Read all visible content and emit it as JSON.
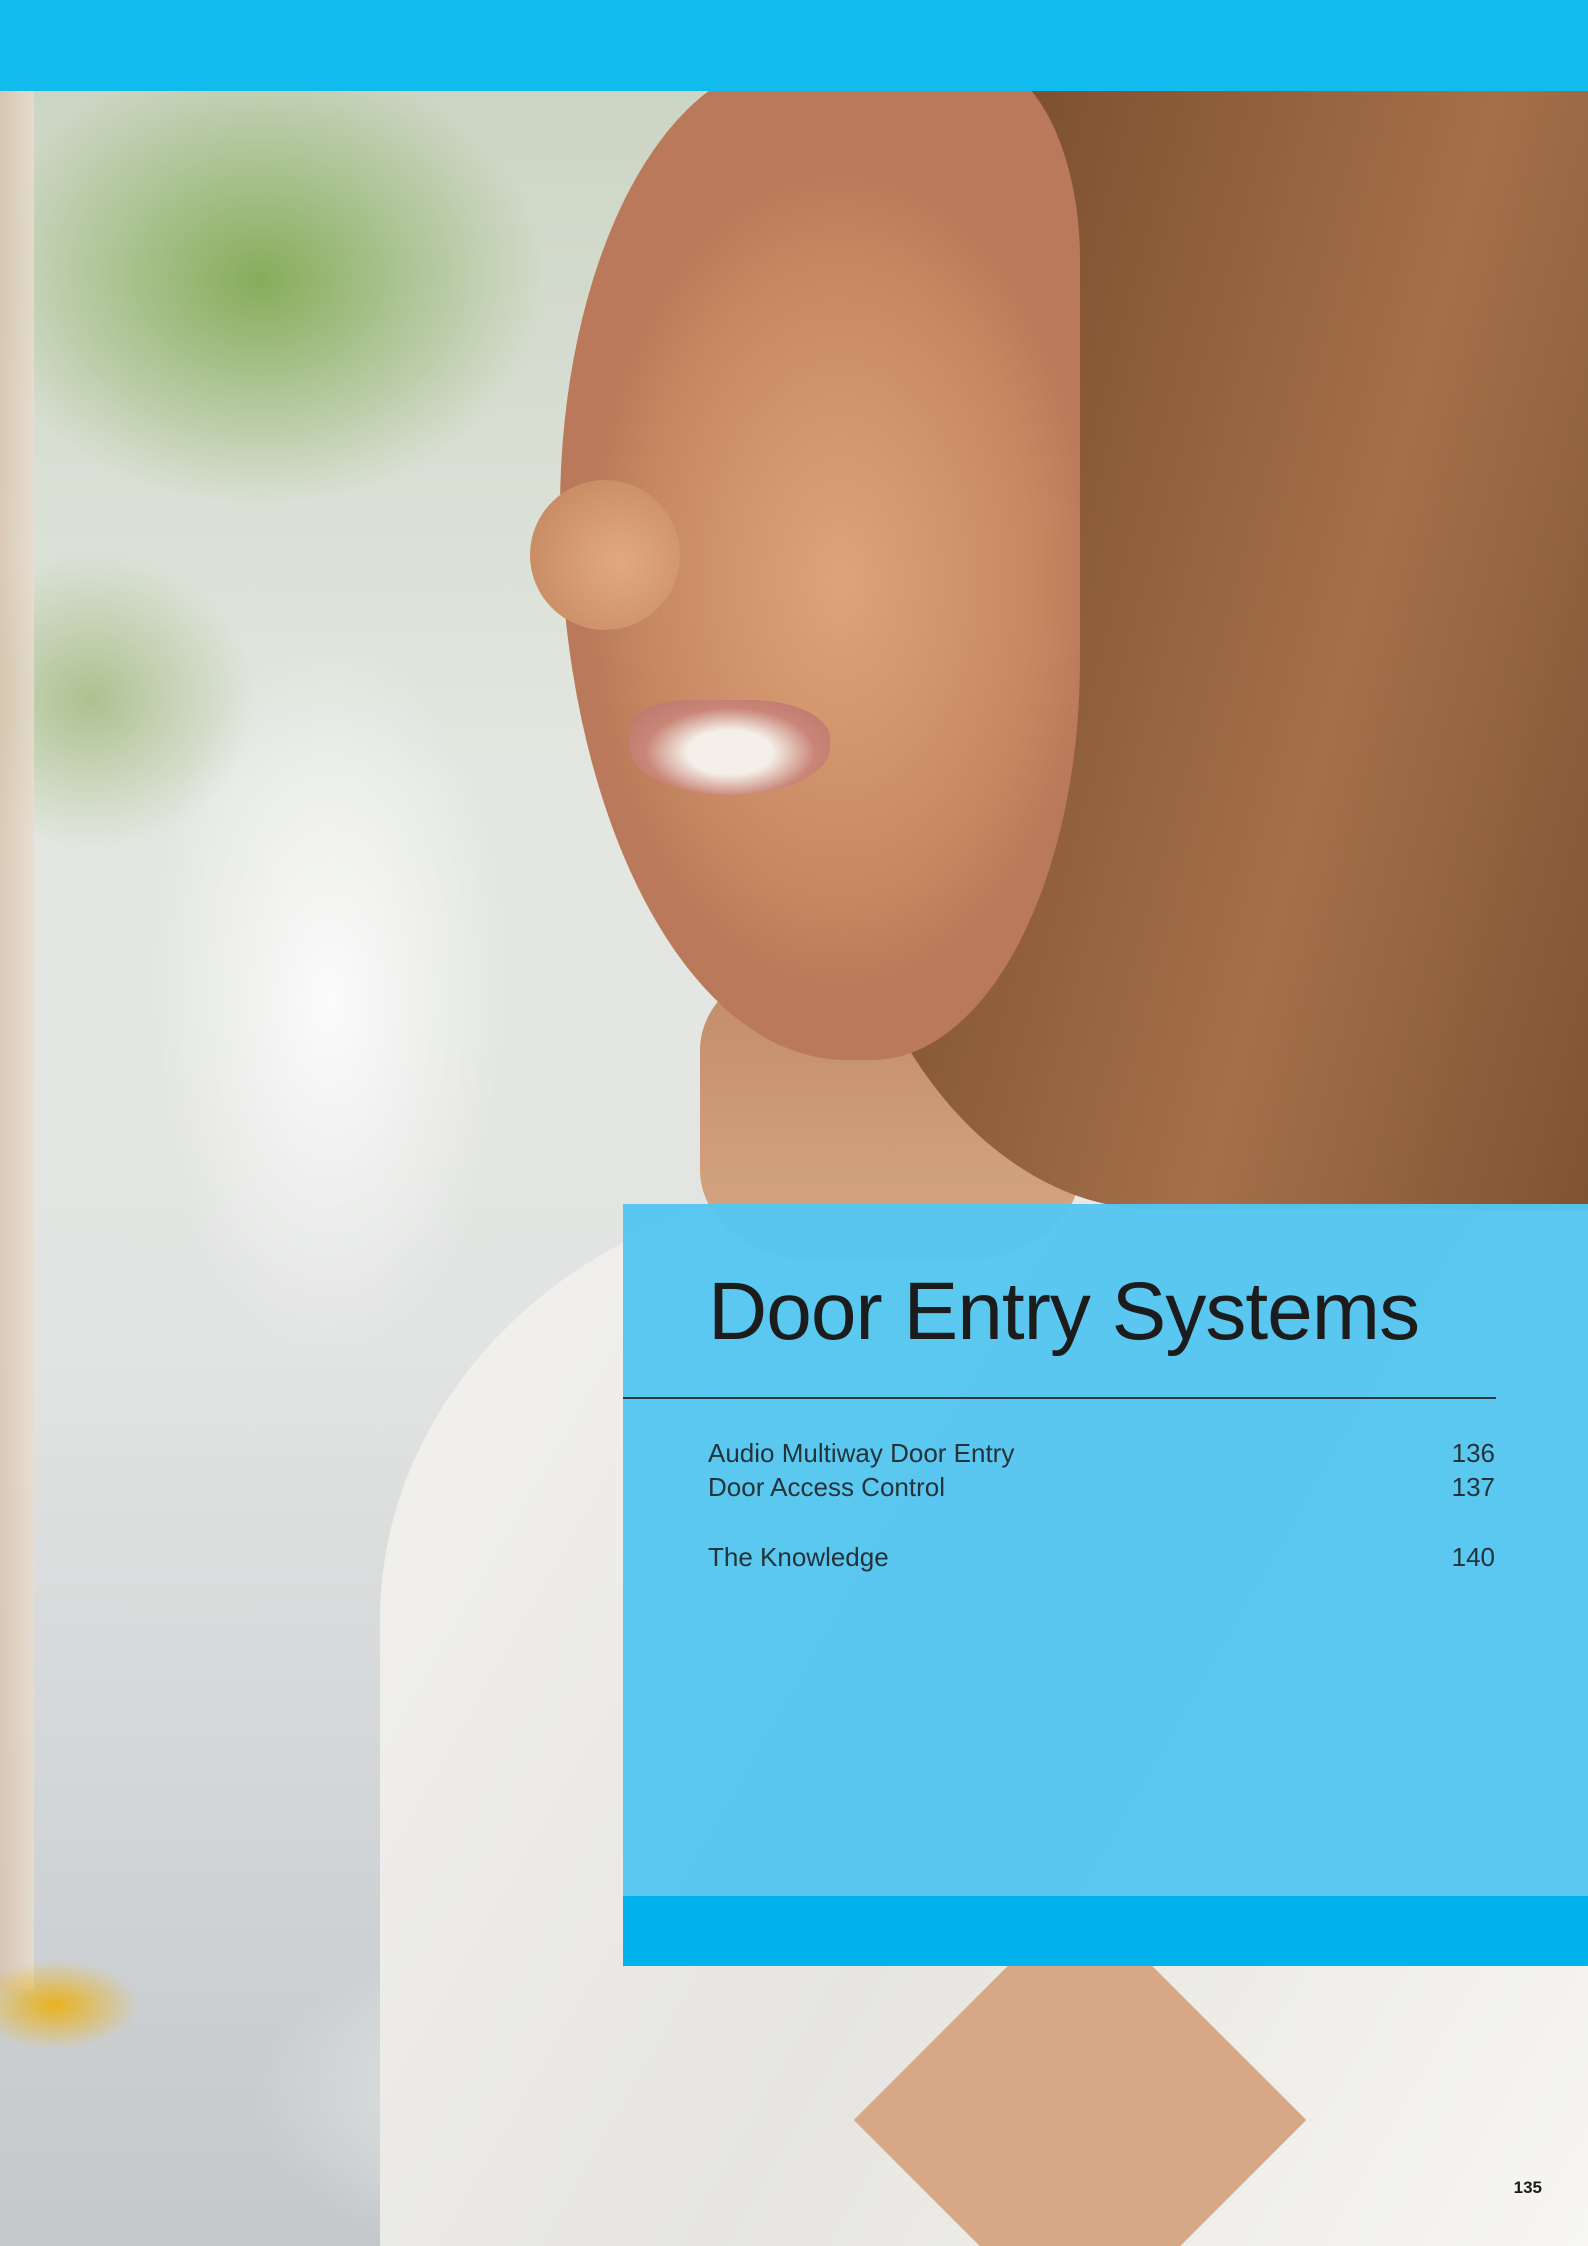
{
  "header": {
    "bar_color": "#11bbee"
  },
  "panel": {
    "title": "Door Entry Systems",
    "background_color": "#54c6f0",
    "footer_color": "#00b3ec",
    "toc": [
      {
        "label": "Audio Multiway Door Entry",
        "page": "136"
      },
      {
        "label": "Door Access Control",
        "page": "137"
      },
      {
        "label": "The Knowledge",
        "page": "140"
      }
    ]
  },
  "footer": {
    "page_number": "135"
  }
}
